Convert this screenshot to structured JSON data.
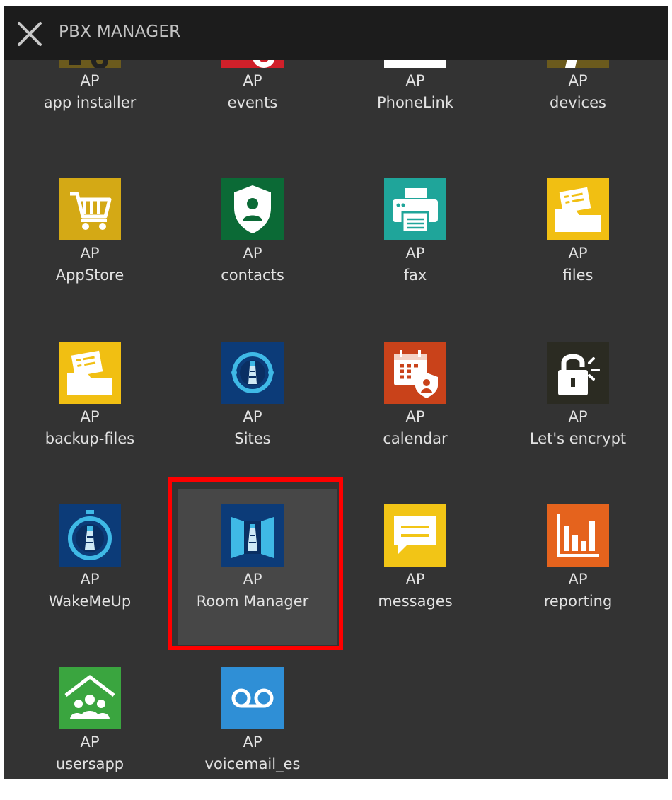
{
  "header": {
    "title": "PBX MANAGER",
    "close_icon": "close-icon"
  },
  "apps": [
    {
      "line1": "AP",
      "line2": "app installer",
      "icon": "app-installer-icon",
      "color": "#6b5a1d"
    },
    {
      "line1": "AP",
      "line2": "events",
      "icon": "events-icon",
      "color": "#d0202a"
    },
    {
      "line1": "AP",
      "line2": "PhoneLink",
      "icon": "phonelink-icon",
      "color": "#ffffff"
    },
    {
      "line1": "AP",
      "line2": "devices",
      "icon": "devices-icon",
      "color": "#6b5a1d"
    },
    {
      "line1": "AP",
      "line2": "AppStore",
      "icon": "shopping-cart-icon",
      "color": "#d4a915"
    },
    {
      "line1": "AP",
      "line2": "contacts",
      "icon": "contacts-shield-icon",
      "color": "#0b6a36"
    },
    {
      "line1": "AP",
      "line2": "fax",
      "icon": "fax-printer-icon",
      "color": "#1fa59a"
    },
    {
      "line1": "AP",
      "line2": "files",
      "icon": "folder-files-icon",
      "color": "#f1bf12"
    },
    {
      "line1": "AP",
      "line2": "backup-files",
      "icon": "folder-backup-icon",
      "color": "#f1bf12"
    },
    {
      "line1": "AP",
      "line2": "Sites",
      "icon": "lighthouse-sites-icon",
      "color": "#0c3b78"
    },
    {
      "line1": "AP",
      "line2": "calendar",
      "icon": "calendar-icon",
      "color": "#c9421a"
    },
    {
      "line1": "AP",
      "line2": "Let's encrypt",
      "icon": "padlock-icon",
      "color": "#2b2b22"
    },
    {
      "line1": "AP",
      "line2": "WakeMeUp",
      "icon": "stopwatch-lighthouse-icon",
      "color": "#0c3b78"
    },
    {
      "line1": "AP",
      "line2": "Room Manager",
      "icon": "room-door-icon",
      "color": "#0c3b78"
    },
    {
      "line1": "AP",
      "line2": "messages",
      "icon": "message-bubble-icon",
      "color": "#f2c516"
    },
    {
      "line1": "AP",
      "line2": "reporting",
      "icon": "bar-chart-icon",
      "color": "#e5631d"
    },
    {
      "line1": "AP",
      "line2": "usersapp",
      "icon": "users-home-icon",
      "color": "#3aa53f"
    },
    {
      "line1": "AP",
      "line2": "voicemail_es",
      "icon": "voicemail-icon",
      "color": "#2f8fd6"
    }
  ],
  "highlight_color": "#ff0000"
}
